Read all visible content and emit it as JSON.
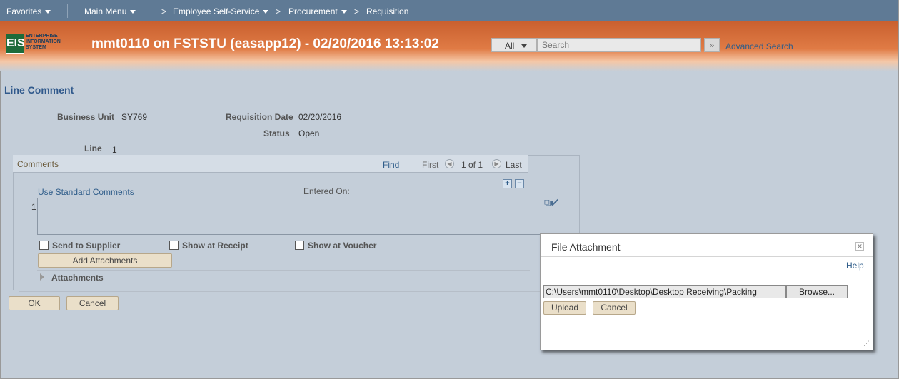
{
  "nav": {
    "favorites": "Favorites",
    "main_menu": "Main Menu",
    "breadcrumbs": [
      ">",
      "Employee Self-Service",
      ">",
      "Procurement",
      ">",
      "Requisition"
    ]
  },
  "header": {
    "logo_mark": "EIS",
    "logo_text": [
      "ENTERPRISE",
      "INFORMATION",
      "SYSTEM"
    ],
    "title": "mmt0110 on FSTSTU (easapp12) - 02/20/2016 13:13:02",
    "search_scope": "All",
    "search_placeholder": "Search",
    "search_go": "»",
    "advanced_search": "Advanced Search"
  },
  "page": {
    "title": "Line Comment",
    "business_unit_label": "Business Unit",
    "business_unit": "SY769",
    "req_date_label": "Requisition Date",
    "req_date": "02/20/2016",
    "status_label": "Status",
    "status": "Open",
    "line_label": "Line",
    "line": "1"
  },
  "comments": {
    "heading": "Comments",
    "find": "Find",
    "first": "First",
    "count": "1 of 1",
    "last": "Last",
    "use_standard": "Use Standard Comments",
    "entered_on": "Entered On:",
    "row_number": "1",
    "send_to_supplier": "Send to Supplier",
    "show_at_receipt": "Show at Receipt",
    "show_at_voucher": "Show at Voucher",
    "add_attachments": "Add Attachments",
    "attachments": "Attachments"
  },
  "buttons": {
    "ok": "OK",
    "cancel": "Cancel"
  },
  "modal": {
    "title": "File Attachment",
    "help": "Help",
    "file_path": "C:\\Users\\mmt0110\\Desktop\\Desktop Receiving\\Packing",
    "browse": "Browse...",
    "upload": "Upload",
    "cancel": "Cancel"
  },
  "colors": {
    "nav_bg": "#5f7a95",
    "banner_orange": "#e07b45",
    "page_bg": "#c4ced9",
    "link": "#2f5d8a"
  }
}
